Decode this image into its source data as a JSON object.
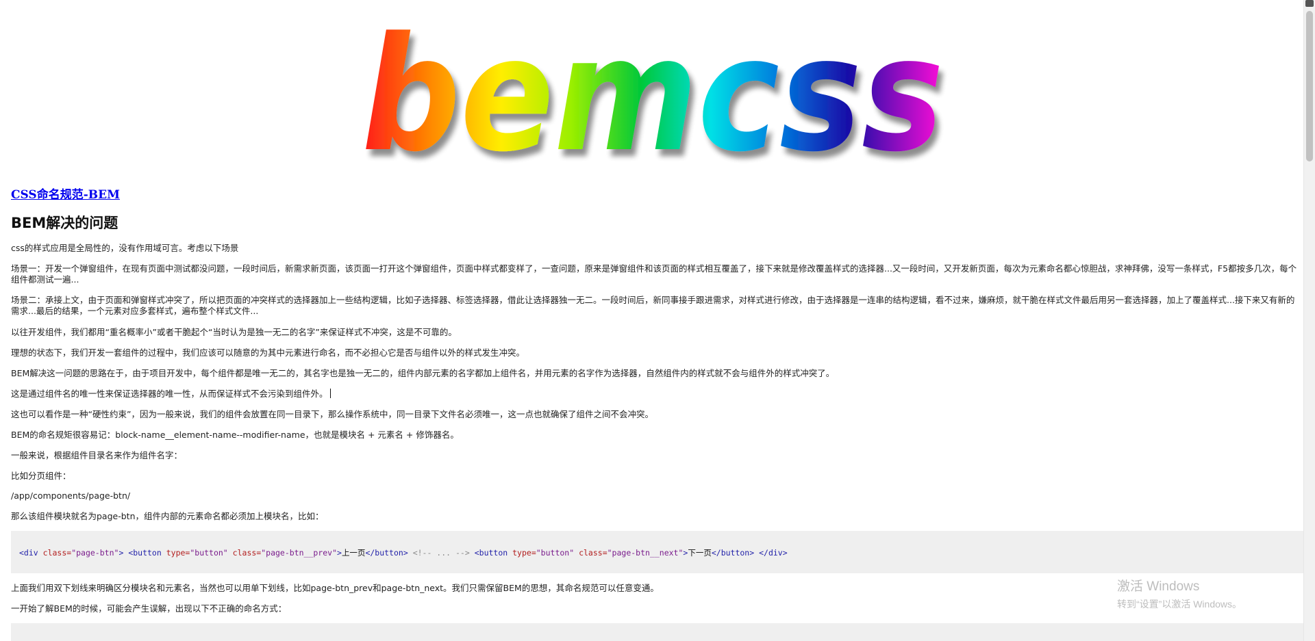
{
  "logo": {
    "text": "bemcss"
  },
  "article": {
    "title_link": "CSS命名规范-BEM",
    "heading": "BEM解决的问题",
    "paragraphs": [
      "css的样式应用是全局性的，没有作用域可言。考虑以下场景",
      "场景一：开发一个弹窗组件，在现有页面中测试都没问题，一段时间后，新需求新页面，该页面一打开这个弹窗组件，页面中样式都变样了，一查问题，原来是弹窗组件和该页面的样式相互覆盖了，接下来就是修改覆盖样式的选择器...又一段时间，又开发新页面，每次为元素命名都心惊胆战，求神拜佛，没写一条样式，F5都按多几次，每个组件都测试一遍...",
      "场景二：承接上文，由于页面和弹窗样式冲突了，所以把页面的冲突样式的选择器加上一些结构逻辑，比如子选择器、标签选择器，借此让选择器独一无二。一段时间后，新同事接手跟进需求，对样式进行修改，由于选择器是一连串的结构逻辑，看不过来，嫌麻烦，就干脆在样式文件最后用另一套选择器，加上了覆盖样式...接下来又有新的需求...最后的结果，一个元素对应多套样式，遍布整个样式文件...",
      "以往开发组件，我们都用“重名概率小”或者干脆起个“当时认为是独一无二的名字”来保证样式不冲突，这是不可靠的。",
      "理想的状态下，我们开发一套组件的过程中，我们应该可以随意的为其中元素进行命名，而不必担心它是否与组件以外的样式发生冲突。",
      "BEM解决这一问题的思路在于，由于项目开发中，每个组件都是唯一无二的，其名字也是独一无二的，组件内部元素的名字都加上组件名，并用元素的名字作为选择器，自然组件内的样式就不会与组件外的样式冲突了。",
      "这是通过组件名的唯一性来保证选择器的唯一性，从而保证样式不会污染到组件外。",
      "这也可以看作是一种“硬性约束”，因为一般来说，我们的组件会放置在同一目录下，那么操作系统中，同一目录下文件名必须唯一，这一点也就确保了组件之间不会冲突。",
      "BEM的命名规矩很容易记：block-name__element-name--modifier-name，也就是模块名 + 元素名 + 修饰器名。",
      "一般来说，根据组件目录名来作为组件名字：",
      "比如分页组件：",
      "/app/components/page-btn/",
      "那么该组件模块就名为page-btn，组件内部的元素命名都必须加上模块名，比如："
    ],
    "code_tokens": {
      "div_open": "<div",
      "class_attr": "class=",
      "class_page_btn": "\"page-btn\"",
      "gt": ">",
      "button_open": "<button",
      "type_attr": "type=",
      "type_button": "\"button\"",
      "class_prev": "\"page-btn__prev\"",
      "prev_text": "上一页",
      "button_close": "</button>",
      "comment": "<!-- ... -->",
      "class_next": "\"page-btn__next\"",
      "next_text": "下一页",
      "div_close": "</div>"
    },
    "after_code": [
      "上面我们用双下划线来明确区分模块名和元素名，当然也可以用单下划线，比如page-btn_prev和page-btn_next。我们只需保留BEM的思想，其命名规范可以任意变通。",
      "一开始了解BEM的时候，可能会产生误解，出现以下不正确的命名方式："
    ]
  },
  "watermark": {
    "title": "激活 Windows",
    "subtitle": "转到“设置”以激活 Windows。"
  }
}
